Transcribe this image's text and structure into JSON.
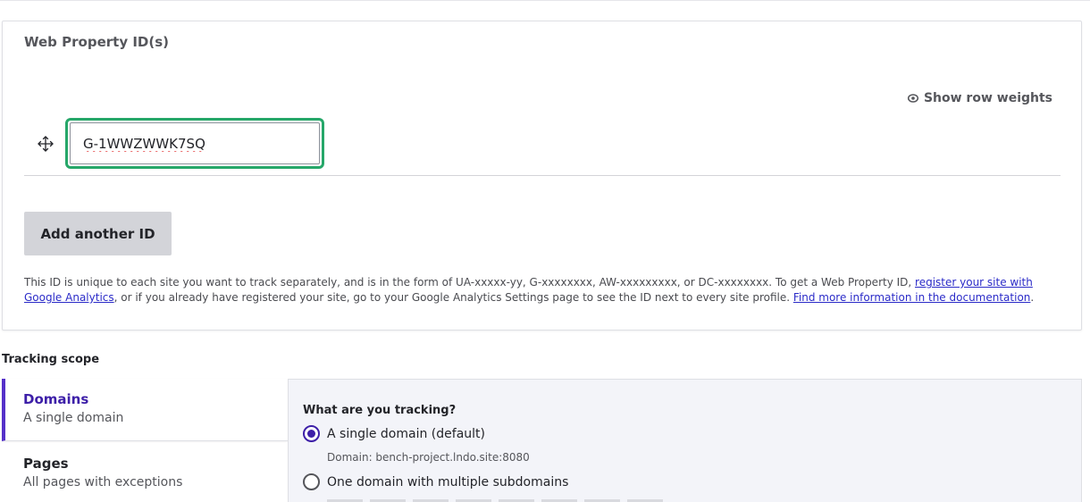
{
  "web_property": {
    "title": "Web Property ID(s)",
    "show_row_weights": "Show row weights",
    "id_value": "G-1WWZWWK7SQ",
    "add_button": "Add another ID",
    "description_part1": "This ID is unique to each site you want to track separately, and is in the form of UA-xxxxx-yy, G-xxxxxxxx, AW-xxxxxxxxx, or DC-xxxxxxxx. To get a Web Property ID, ",
    "description_link1": "register your site with Google Analytics",
    "description_part2": ", or if you already have registered your site, go to your Google Analytics Settings page to see the ID next to every site profile. ",
    "description_link2": "Find more information in the documentation",
    "description_part3": "."
  },
  "tracking_scope": {
    "label": "Tracking scope",
    "tabs": [
      {
        "title": "Domains",
        "subtitle": "A single domain"
      },
      {
        "title": "Pages",
        "subtitle": "All pages with exceptions"
      }
    ],
    "pane": {
      "heading": "What are you tracking?",
      "options": [
        {
          "label": "A single domain (default)",
          "description": "Domain: bench-project.lndo.site:8080",
          "checked": true
        },
        {
          "label": "One domain with multiple subdomains",
          "checked": false
        }
      ]
    }
  },
  "colors": {
    "accent": "#3d1fa8",
    "focus_ring": "#26a769",
    "link": "#2b2bc8"
  }
}
